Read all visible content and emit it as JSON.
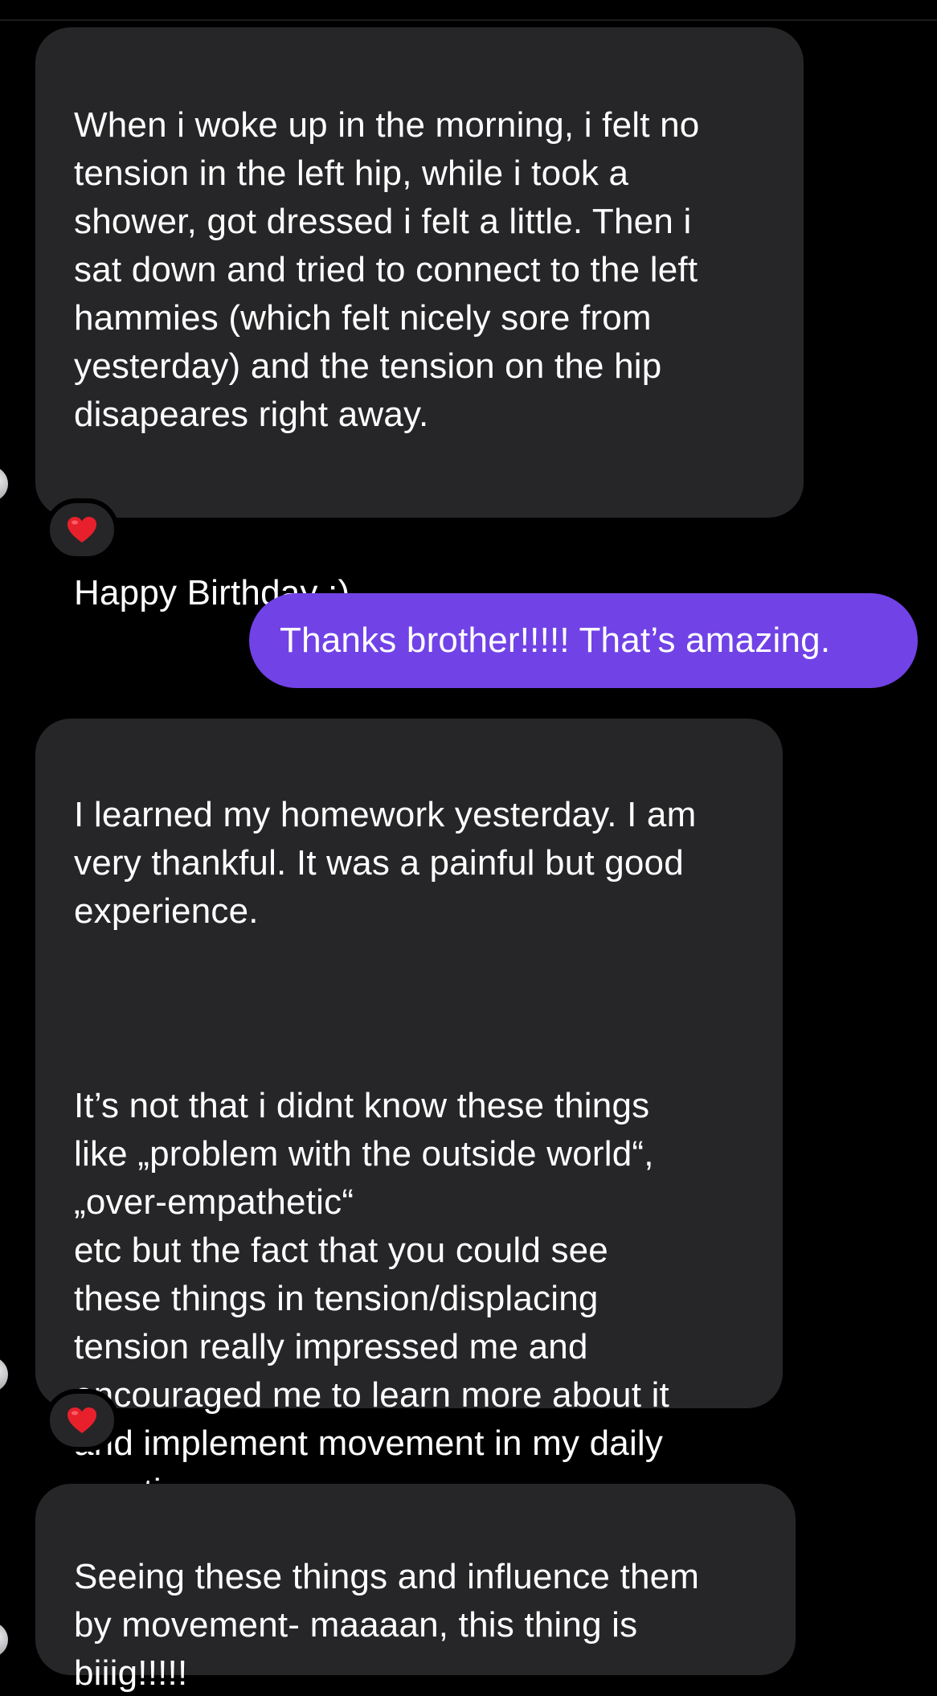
{
  "conversation": {
    "messages": [
      {
        "direction": "incoming",
        "paragraphs": [
          "When i woke up in the morning, i felt no\ntension in the left hip, while i took a\nshower, got dressed i felt a little. Then i\nsat down and tried to connect to the left\nhammies (which felt nicely sore from\nyesterday) and the tension on the hip\ndisapeares right away.",
          "Happy Birthday :)"
        ],
        "reaction": "❤️"
      },
      {
        "direction": "outgoing",
        "text": "Thanks brother!!!!! That’s amazing."
      },
      {
        "direction": "incoming",
        "paragraphs": [
          "I learned my homework yesterday. I am\nvery thankful. It was a painful but good\nexperience.",
          "It’s not that i didnt know these things\nlike „problem with the outside world“,\n„over-empathetic“\netc but the fact that you could see\nthese things in tension/displacing\ntension really impressed me and\nencouraged me to learn more about it\nand implement movement in my daily\npractice."
        ],
        "reaction": "❤️"
      },
      {
        "direction": "incoming",
        "paragraphs": [
          "Seeing these things and influence them\nby movement- maaaan, this thing is\nbiiig!!!!!"
        ]
      }
    ]
  },
  "theme": {
    "background": "#000000",
    "incoming_bubble": "#262628",
    "outgoing_bubble": "#7142e6",
    "text": "#ffffff",
    "reaction_icon": "heart-icon"
  }
}
